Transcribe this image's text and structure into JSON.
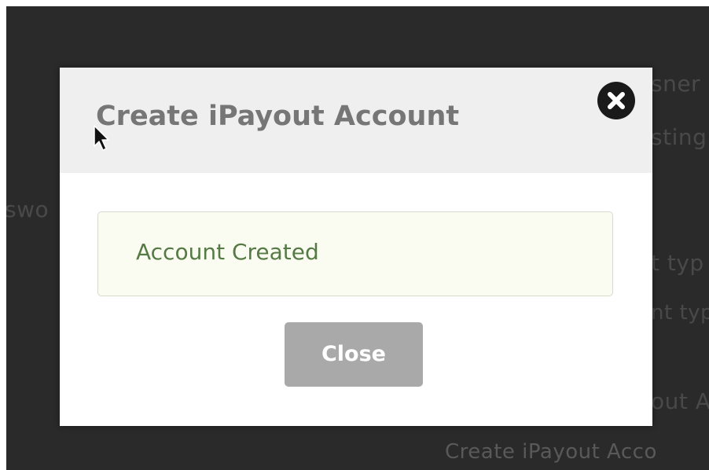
{
  "background": {
    "fragments": [
      "sner",
      "sting",
      "swo",
      "t typ",
      "nt typ",
      "out A",
      "Create iPayout Acco"
    ]
  },
  "modal": {
    "title": "Create iPayout Account",
    "close_icon": "close-circle-icon",
    "alert_message": "Account Created",
    "close_button_label": "Close"
  },
  "colors": {
    "backdrop": "#2b2a2a",
    "header_bg": "#efefef",
    "alert_bg": "#fbfcf1",
    "alert_text": "#557a45",
    "button_bg": "#a9a9a9"
  }
}
